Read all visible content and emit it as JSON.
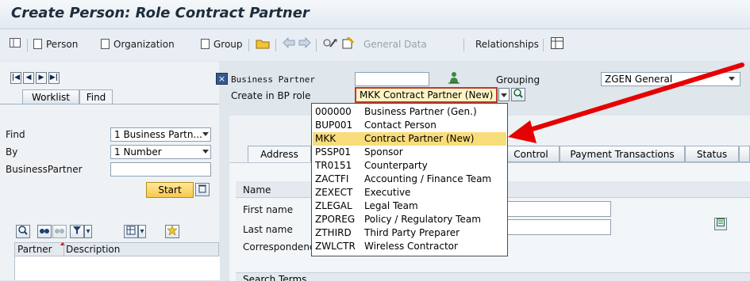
{
  "window": {
    "title": "Create Person: Role Contract Partner"
  },
  "toolbar": {
    "person": "Person",
    "organization": "Organization",
    "group": "Group",
    "general_data": "General Data",
    "relationships": "Relationships"
  },
  "left_panel": {
    "tabs": [
      "Worklist",
      "Find"
    ],
    "find_label": "Find",
    "find_value": "1 Business Partn...",
    "by_label": "By",
    "by_value": "1 Number",
    "bp_label": "BusinessPartner",
    "bp_value": "",
    "start_button": "Start",
    "list_headers": [
      "Partner",
      "Description"
    ]
  },
  "header_fields": {
    "business_partner_label": "Business Partner",
    "business_partner_value": "",
    "grouping_label": "Grouping",
    "grouping_value": "ZGEN General",
    "create_in_role_label": "Create in BP role",
    "create_in_role_value": "MKK Contract Partner (New)"
  },
  "role_dropdown": {
    "options": [
      {
        "code": "000000",
        "text": "Business Partner (Gen.)"
      },
      {
        "code": "BUP001",
        "text": "Contact Person"
      },
      {
        "code": "MKK",
        "text": "Contract Partner (New)"
      },
      {
        "code": "PSSP01",
        "text": "Sponsor"
      },
      {
        "code": "TR0151",
        "text": "Counterparty"
      },
      {
        "code": "ZACTFI",
        "text": "Accounting / Finance Team"
      },
      {
        "code": "ZEXECT",
        "text": "Executive"
      },
      {
        "code": "ZLEGAL",
        "text": "Legal Team"
      },
      {
        "code": "ZPOREG",
        "text": "Policy / Regulatory Team"
      },
      {
        "code": "ZTHIRD",
        "text": "Third Party Preparer"
      },
      {
        "code": "ZWLCTR",
        "text": "Wireless Contractor"
      }
    ],
    "selected": "MKK"
  },
  "detail_tabs": [
    "Address",
    "Control",
    "Payment Transactions",
    "Status"
  ],
  "form": {
    "name_section": "Name",
    "first_name_label": "First name",
    "last_name_label": "Last name",
    "correspondence_label": "Correspondence",
    "search_terms_section": "Search Terms"
  },
  "colors": {
    "arrow": "#e60000",
    "selected_row": "#f9dd7b",
    "dropdown_border": "#c0392b"
  }
}
